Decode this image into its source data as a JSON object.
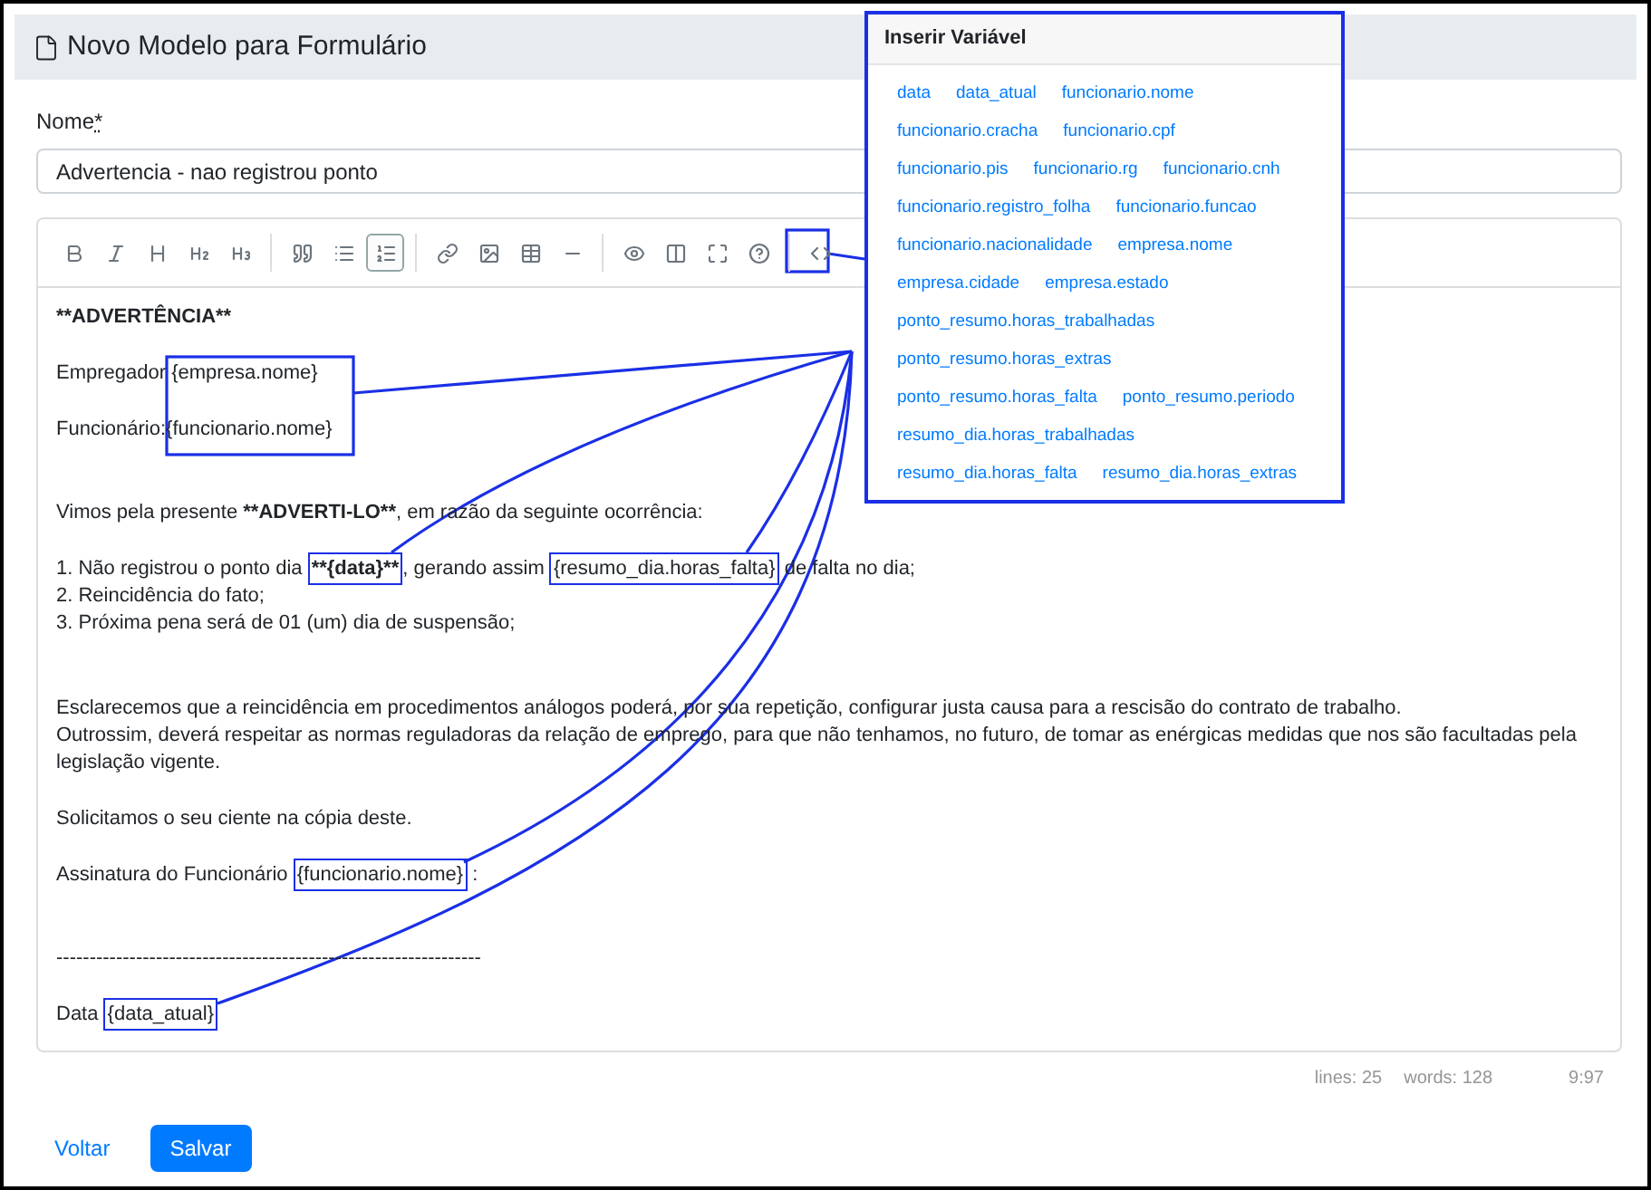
{
  "header": {
    "title": "Novo Modelo para Formulário"
  },
  "name_field": {
    "label": "Nome",
    "required_mark": "*",
    "value": "Advertencia - nao registrou ponto"
  },
  "toolbar": {
    "groups": [
      [
        {
          "active": false
        },
        {
          "active": false
        },
        {
          "active": false
        },
        {
          "active": false
        },
        {
          "active": false
        }
      ],
      [
        {
          "active": false
        },
        {
          "active": false
        },
        {
          "active": true
        }
      ],
      [
        {
          "active": false
        },
        {
          "active": false
        },
        {
          "active": false
        },
        {
          "active": false
        }
      ],
      [
        {
          "active": false
        },
        {
          "active": false
        },
        {
          "active": false
        },
        {
          "active": false
        }
      ],
      [
        {
          "active": false
        }
      ]
    ]
  },
  "editor_lines": [
    {
      "kind": "text",
      "parts": [
        {
          "text": "**ADVERTÊNCIA**",
          "bold": true
        }
      ]
    },
    {
      "kind": "blank"
    },
    {
      "kind": "text",
      "parts": [
        {
          "text": "Empregador {empresa.nome}",
          "bold": false
        }
      ]
    },
    {
      "kind": "blank"
    },
    {
      "kind": "text",
      "parts": [
        {
          "text": "Funcionário:{funcionario.nome}",
          "bold": false
        }
      ]
    },
    {
      "kind": "blank"
    },
    {
      "kind": "blank"
    },
    {
      "kind": "text",
      "parts": [
        {
          "text": "Vimos pela presente ",
          "bold": false
        },
        {
          "text": "**ADVERTI-LO**",
          "bold": true
        },
        {
          "text": ", em razão da seguinte ocorrência:",
          "bold": false
        }
      ]
    },
    {
      "kind": "blank"
    },
    {
      "kind": "text",
      "parts": [
        {
          "text": "1. Não registrou o ponto dia ",
          "bold": false
        },
        {
          "text": "**{data}**",
          "bold": true,
          "framed": true
        },
        {
          "text": ", gerando assim ",
          "bold": false
        },
        {
          "text": "{resumo_dia.horas_falta}",
          "bold": false,
          "framed": true
        },
        {
          "text": " de falta no dia;",
          "bold": false
        }
      ]
    },
    {
      "kind": "text",
      "parts": [
        {
          "text": "2. Reincidência do fato;",
          "bold": false
        }
      ]
    },
    {
      "kind": "text",
      "parts": [
        {
          "text": "3. Próxima pena será de 01 (um) dia de suspensão;",
          "bold": false
        }
      ]
    },
    {
      "kind": "blank"
    },
    {
      "kind": "blank"
    },
    {
      "kind": "text",
      "parts": [
        {
          "text": "Esclarecemos que a reincidência em procedimentos análogos poderá, por sua repetição, configurar justa causa para a rescisão do contrato de trabalho.",
          "bold": false
        }
      ]
    },
    {
      "kind": "text",
      "parts": [
        {
          "text": "Outrossim, deverá respeitar as normas reguladoras da relação de emprego, para que não tenhamos, no futuro, de tomar as enérgicas medidas que nos são facultadas pela legislação vigente.",
          "bold": false
        }
      ]
    },
    {
      "kind": "blank"
    },
    {
      "kind": "text",
      "parts": [
        {
          "text": "Solicitamos o seu ciente na cópia deste.",
          "bold": false
        }
      ]
    },
    {
      "kind": "blank"
    },
    {
      "kind": "text",
      "parts": [
        {
          "text": "Assinatura do Funcionário ",
          "bold": false
        },
        {
          "text": "{funcionario.nome}",
          "bold": false,
          "framed": true
        },
        {
          "text": " :",
          "bold": false
        }
      ]
    },
    {
      "kind": "blank"
    },
    {
      "kind": "blank"
    },
    {
      "kind": "text",
      "parts": [
        {
          "text": "----------------------------------------------------------------",
          "bold": false
        }
      ]
    },
    {
      "kind": "blank"
    },
    {
      "kind": "text",
      "parts": [
        {
          "text": "Data ",
          "bold": false
        },
        {
          "text": "{data_atual}",
          "bold": false,
          "framed": true
        }
      ]
    }
  ],
  "status_bar": {
    "lines": "lines: 25",
    "words": "words: 128",
    "cursor": "9:97"
  },
  "buttons": {
    "back": "Voltar",
    "save": "Salvar"
  },
  "variable_panel": {
    "title": "Inserir Variável",
    "variables": [
      "data",
      "data_atual",
      "funcionario.nome",
      "funcionario.cracha",
      "funcionario.cpf",
      "funcionario.pis",
      "funcionario.rg",
      "funcionario.cnh",
      "funcionario.registro_folha",
      "funcionario.funcao",
      "funcionario.nacionalidade",
      "empresa.nome",
      "empresa.cidade",
      "empresa.estado",
      "ponto_resumo.horas_trabalhadas",
      "ponto_resumo.horas_extras",
      "ponto_resumo.horas_falta",
      "ponto_resumo.periodo",
      "resumo_dia.horas_trabalhadas",
      "resumo_dia.horas_falta",
      "resumo_dia.horas_extras"
    ]
  }
}
